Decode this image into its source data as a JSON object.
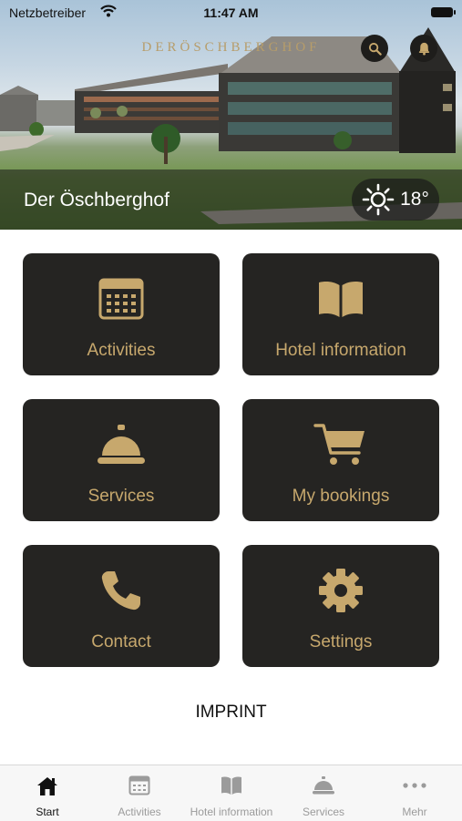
{
  "status_bar": {
    "carrier": "Netzbetreiber",
    "time": "11:47 AM"
  },
  "hero": {
    "brand_text": "DERÖSCHBERGHOF",
    "hotel_name": "Der Öschberghof",
    "temperature": "18°",
    "weather_icon": "sun-icon"
  },
  "tiles": [
    {
      "label": "Activities",
      "icon": "calendar-icon"
    },
    {
      "label": "Hotel information",
      "icon": "book-icon"
    },
    {
      "label": "Services",
      "icon": "service-bell-icon"
    },
    {
      "label": "My bookings",
      "icon": "shopping-cart-icon"
    },
    {
      "label": "Contact",
      "icon": "phone-icon"
    },
    {
      "label": "Settings",
      "icon": "gear-icon"
    }
  ],
  "imprint_label": "IMPRINT",
  "tabbar": {
    "active": "Start",
    "items": [
      {
        "label": "Start",
        "icon": "home-icon"
      },
      {
        "label": "Activities",
        "icon": "calendar-icon"
      },
      {
        "label": "Hotel information",
        "icon": "book-icon"
      },
      {
        "label": "Services",
        "icon": "service-bell-icon"
      },
      {
        "label": "Mehr",
        "icon": "more-icon"
      }
    ]
  },
  "colors": {
    "accent": "#c7a86d",
    "tile_bg": "#252422",
    "tab_active": "#111111",
    "tab_inactive": "#9b9b9b"
  }
}
